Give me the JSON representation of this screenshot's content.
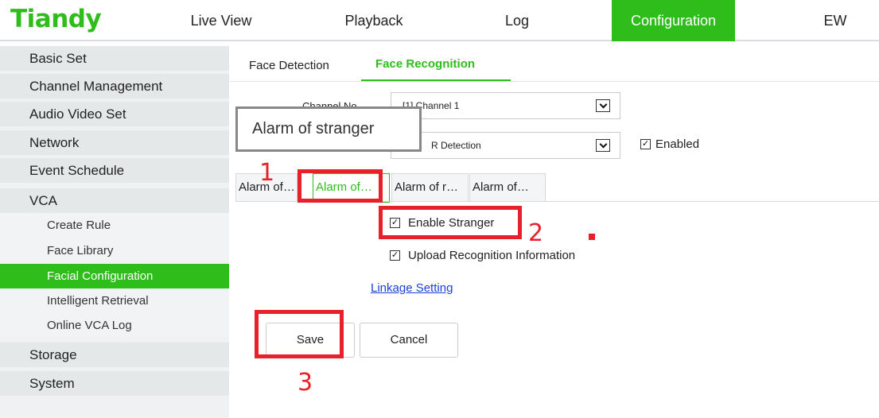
{
  "header": {
    "logo": "Tiandy",
    "nav": {
      "live_view": "Live View",
      "playback": "Playback",
      "log": "Log",
      "configuration": "Configuration",
      "ew": "EW"
    },
    "accent_color": "#2fbd1c"
  },
  "sidebar": {
    "basic_set": "Basic Set",
    "channel_management": "Channel Management",
    "audio_video_set": "Audio Video Set",
    "network": "Network",
    "event_schedule": "Event Schedule",
    "vca": "VCA",
    "vca_items": {
      "create_rule": "Create Rule",
      "face_library": "Face Library",
      "facial_configuration": "Facial Configuration",
      "intelligent_retrieval": "Intelligent Retrieval",
      "online_vca_log": "Online VCA Log"
    },
    "storage": "Storage",
    "system": "System"
  },
  "main": {
    "tabs": {
      "face_detection": "Face Detection",
      "face_recognition": "Face Recognition"
    },
    "channel_label": "Channel No.",
    "channel_value": "[1] Channel 1",
    "mode_value": "R Detection",
    "enabled_label": "Enabled",
    "tooltip": "Alarm of stranger",
    "subtabs": {
      "t1": "Alarm of…",
      "t2": "Alarm of…",
      "t3": "Alarm of r…",
      "t4": "Alarm of…"
    },
    "enable_stranger": "Enable Stranger",
    "upload_info": "Upload Recognition Information",
    "linkage_setting": "Linkage Setting",
    "save": "Save",
    "cancel": "Cancel"
  },
  "annotations": {
    "step1": "1",
    "step2": "2",
    "step3": "3",
    "color": "#e8202a"
  }
}
